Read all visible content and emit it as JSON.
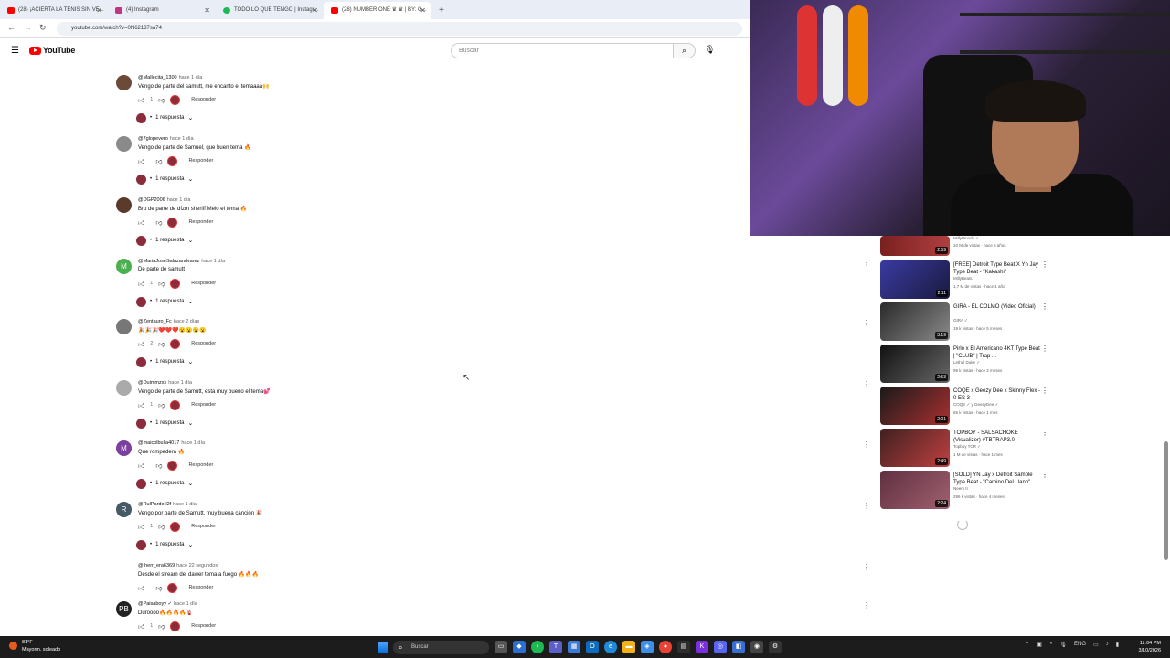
{
  "browser": {
    "tabs": [
      {
        "label": "(28) ¡ACIERTA LA TENIS SIN VE...",
        "icon": "youtube-icon",
        "color": "#ff0000"
      },
      {
        "label": "(4) Instagram",
        "icon": "instagram-icon",
        "color": "#c13584"
      },
      {
        "label": "TODO LO QUE TENGO | Instagr...",
        "icon": "spotify-icon",
        "color": "#1db954"
      },
      {
        "label": "(28) NUMBER ONE ♛ ♛ | BY: G...",
        "icon": "youtube-icon",
        "color": "#ff0000"
      }
    ],
    "new_tab": "+",
    "url": "youtube.com/watch?v=0N62137sa74"
  },
  "youtube": {
    "logo_text": "YouTube",
    "search_placeholder": "Buscar"
  },
  "comments": [
    {
      "user": "@Mallecita_1300",
      "time": "hace 1 día",
      "text": "Vengo de parte del samutt, me encanto el temaaaa🙌",
      "likes": "1",
      "reply": "Responder",
      "replies": "1 respuesta",
      "avatar_color": "#6b4a3a",
      "avatar_letter": ""
    },
    {
      "user": "@7glopevero",
      "time": "hace 1 día",
      "text": "Vengo de parte de Samuel, que buen tema 🔥",
      "likes": "",
      "reply": "Responder",
      "replies": "1 respuesta",
      "avatar_color": "#8a8a8a",
      "avatar_letter": ""
    },
    {
      "user": "@DGP2006",
      "time": "hace 1 día",
      "text": "Bro de parte de dfzm sheriff Melo el tema 🔥",
      "likes": "",
      "reply": "Responder",
      "replies": "1 respuesta",
      "avatar_color": "#5a3a2a",
      "avatar_letter": ""
    },
    {
      "user": "@MariaJoséSalazaralvarez",
      "time": "hace 1 día",
      "text": "De parte de samutt",
      "likes": "1",
      "reply": "Responder",
      "replies": "1 respuesta",
      "avatar_color": "#4caf50",
      "avatar_letter": "M"
    },
    {
      "user": "@Zentauro_Fc",
      "time": "hace 2 días",
      "text": "🎉🎉🎉❤️❤️❤️😮😮😮😮",
      "likes": "2",
      "reply": "Responder",
      "replies": "1 respuesta",
      "avatar_color": "#777777",
      "avatar_letter": ""
    },
    {
      "user": "@Duimmzxx",
      "time": "hace 1 día",
      "text": "Vengo de parte de Samutt, esta muy bueno el tema💕",
      "likes": "1",
      "reply": "Responder",
      "replies": "1 respuesta",
      "avatar_color": "#aaaaaa",
      "avatar_letter": ""
    },
    {
      "user": "@maicolbulla4017",
      "time": "hace 1 día",
      "text": "Que rompedera 🔥",
      "likes": "",
      "reply": "Responder",
      "replies": "1 respuesta",
      "avatar_color": "#7b3fa0",
      "avatar_letter": "M"
    },
    {
      "user": "@RulPardo-l2f",
      "time": "hace 1 día",
      "text": "Vengo por parte de Samutt, muy buena canción 🎉",
      "likes": "1",
      "reply": "Responder",
      "replies": "1 respuesta",
      "avatar_color": "#455a64",
      "avatar_letter": "R"
    },
    {
      "user": "@therr_era6369",
      "time": "hace 22 segundos",
      "text": "Desde el stream del dawer tema a fuego 🔥🔥🔥",
      "likes": "",
      "reply": "Responder",
      "replies": "",
      "avatar_color": "#ffffff",
      "avatar_letter": ""
    },
    {
      "user": "@Paisaboyy ✓",
      "time": "hace 1 día",
      "text": "Duroooo🔥🔥🔥🔥🧯",
      "likes": "1",
      "reply": "Responder",
      "replies": "",
      "avatar_color": "#222222",
      "avatar_letter": "PB"
    }
  ],
  "sidebar": {
    "partial": {
      "channel": "MillyWoods ✓",
      "meta": "10 M de vistas · hace 5 años",
      "duration": "2:59"
    },
    "videos": [
      {
        "title": "[FREE] Detroit Type Beat X Yn Jay Type Beat - \"Kakashi\"",
        "channel": "MillyBeats",
        "meta": "1,7 M de vistas · hace 1 año",
        "duration": "2:11",
        "colors": [
          "#3a3aa0",
          "#1a1a40"
        ]
      },
      {
        "title": "GIRA - EL COLMO (Video Oficial)",
        "channel": "GIRA ✓",
        "meta": "19 k vistas · hace 5 meses",
        "duration": "3:19",
        "colors": [
          "#2a2a2a",
          "#8a8a8a"
        ]
      },
      {
        "title": "Pirlo x El Americano 4KT Type Beat | \"CLUB\" | Trap ...",
        "channel": "Lethal Duke ✓",
        "meta": "99 k vistas · hace 2 meses",
        "duration": "2:53",
        "colors": [
          "#111111",
          "#666666"
        ]
      },
      {
        "title": "COQE x Geezy Dee x Skinny Flex - 0 ES 3",
        "channel": "COQE ✓ y GeezyDee ✓",
        "meta": "65 k vistas · hace 1 mes",
        "duration": "2:01",
        "colors": [
          "#1a1a1a",
          "#aa3030"
        ]
      },
      {
        "title": "TOPBOY - SALSACHOKE (Visualizer) #TBTRAP3.0",
        "channel": "Topboy TCR ✓",
        "meta": "1 M de vistas · hace 1 mes",
        "duration": "2:49",
        "colors": [
          "#402020",
          "#c04040"
        ]
      },
      {
        "title": "[SOLD] YN Jay x Detroit Sample Type Beat - \"Camino Del Llano\"",
        "channel": "Neem II",
        "meta": "296 k vistas · hace 4 meses",
        "duration": "2:24",
        "colors": [
          "#603040",
          "#a06070"
        ]
      }
    ]
  },
  "taskbar": {
    "weather_temp": "81°F",
    "weather_text": "Mayorm. soleado",
    "search": "Buscar",
    "lang": "ENG",
    "time": "11:04 PM",
    "date": "3/10/2026"
  }
}
